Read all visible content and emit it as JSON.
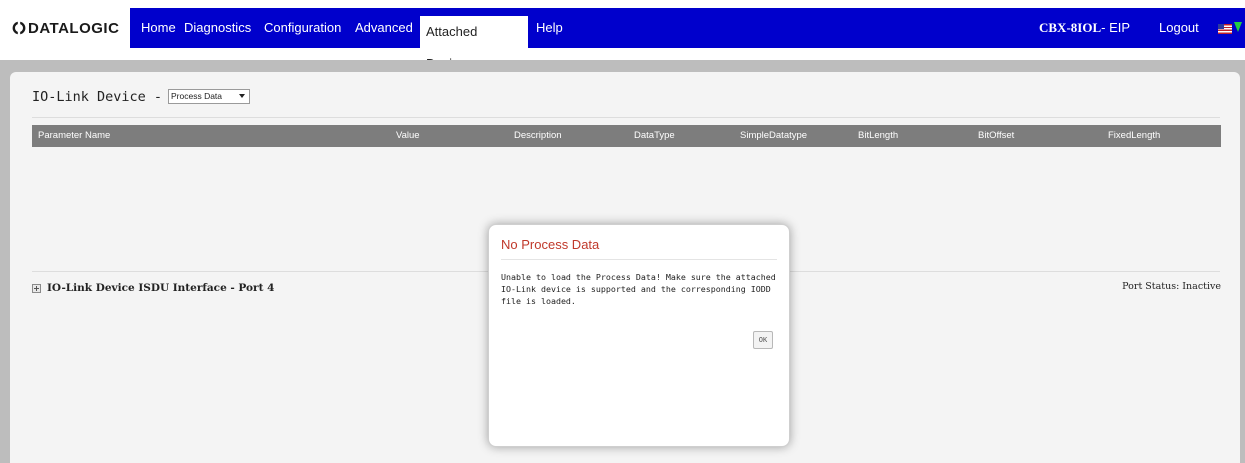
{
  "brand": {
    "logo_text": "DATALOGIC"
  },
  "nav": {
    "items": [
      {
        "label": "Home"
      },
      {
        "label": "Diagnostics"
      },
      {
        "label": "Configuration"
      },
      {
        "label": "Advanced"
      },
      {
        "label": "Attached Devices",
        "active": true
      },
      {
        "label": "Help"
      }
    ],
    "device_model": "CBX-8IOL",
    "device_suffix": "- EIP",
    "logout_label": "Logout"
  },
  "section": {
    "title": "IO-Link Device - Port 4",
    "select_value": "Process Data"
  },
  "table": {
    "headers": [
      "Parameter Name",
      "Value",
      "Description",
      "DataType",
      "SimpleDatatype",
      "BitLength",
      "BitOffset",
      "FixedLength"
    ]
  },
  "isdu": {
    "label": "IO-Link Device ISDU Interface - Port 4",
    "port_status": "Port Status: Inactive"
  },
  "modal": {
    "title": "No Process Data",
    "message": "Unable to load the Process Data! Make sure the attached IO-Link device is supported and the corresponding IODD file is loaded.",
    "ok_label": "OK"
  },
  "colors": {
    "nav_blue": "#0000cc",
    "modal_title_red": "#c0392b",
    "table_header_grey": "#7d7d7d",
    "page_grey": "#bdbdbd"
  }
}
